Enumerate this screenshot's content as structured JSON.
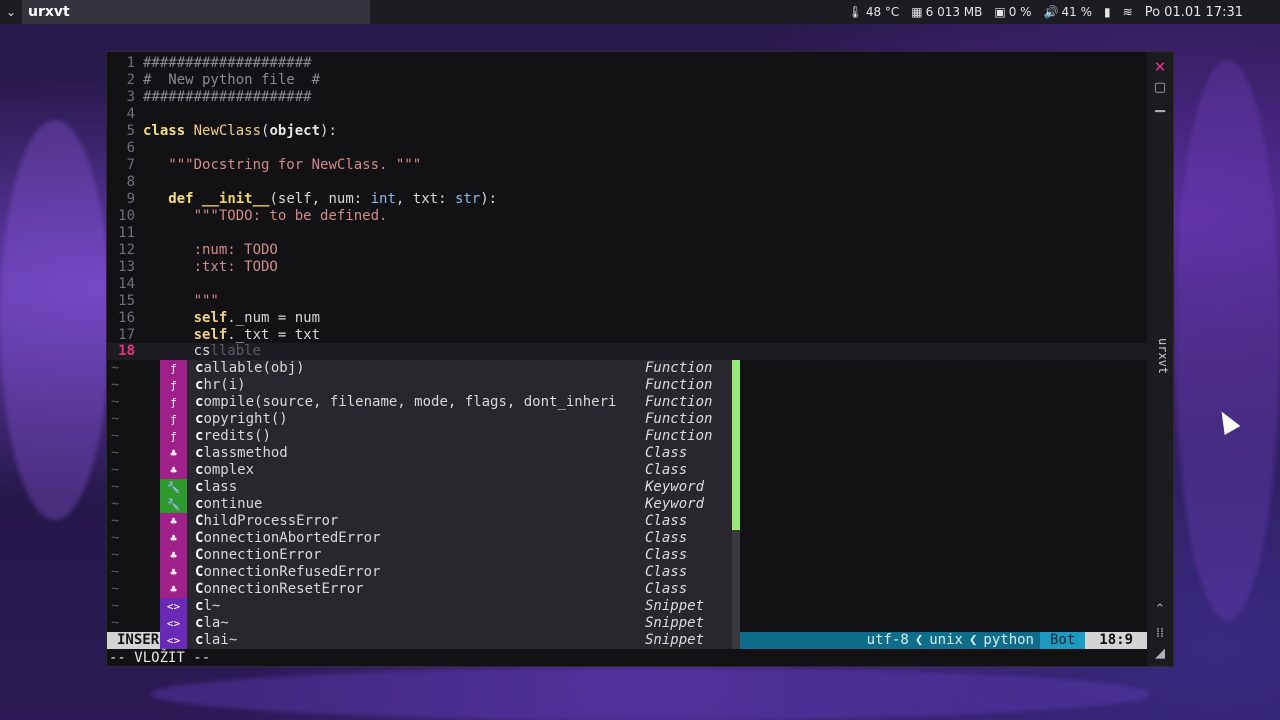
{
  "topbar": {
    "app_title": "urxvt",
    "temp": "48 °C",
    "memory": "6 013 MB",
    "cpu": "0 %",
    "volume": "41 %",
    "clock": "Po 01.01 17:31"
  },
  "window": {
    "wm_label": "urxvt"
  },
  "editor": {
    "lines": [
      {
        "n": "1",
        "t": "####################"
      },
      {
        "n": "2",
        "t": "#  New python file  #"
      },
      {
        "n": "3",
        "t": "####################"
      },
      {
        "n": "4",
        "t": ""
      },
      {
        "n": "5",
        "kw": "class",
        "cls": "NewClass",
        "bi": "object"
      },
      {
        "n": "6",
        "t": ""
      },
      {
        "n": "7",
        "str": "\"\"\"Docstring for NewClass. \"\"\""
      },
      {
        "n": "8",
        "t": ""
      },
      {
        "n": "9",
        "kw": "def",
        "fn": "__init__",
        "params_a": "(self, num: ",
        "ty1": "int",
        "params_b": ", txt: ",
        "ty2": "str",
        "params_c": "):"
      },
      {
        "n": "10",
        "str": "\"\"\"TODO: to be defined."
      },
      {
        "n": "11",
        "t": ""
      },
      {
        "n": "12",
        "str": ":num: TODO"
      },
      {
        "n": "13",
        "str": ":txt: TODO"
      },
      {
        "n": "14",
        "t": ""
      },
      {
        "n": "15",
        "str": "\"\"\""
      },
      {
        "n": "16",
        "self": "self",
        "rest": "._num = num"
      },
      {
        "n": "17",
        "self": "self",
        "rest": "._txt = txt"
      },
      {
        "n": "18",
        "typed": "cs",
        "ghost": "llable"
      }
    ],
    "tilde": "~"
  },
  "completion": {
    "items": [
      {
        "icon": "function-icon",
        "glyph": "ƒ",
        "color": "#a0208a",
        "first": "c",
        "rest": "allable(obj)",
        "kind": "Function"
      },
      {
        "icon": "function-icon",
        "glyph": "ƒ",
        "color": "#a0208a",
        "first": "c",
        "rest": "hr(i)",
        "kind": "Function"
      },
      {
        "icon": "function-icon",
        "glyph": "ƒ",
        "color": "#a0208a",
        "first": "c",
        "rest": "ompile(source, filename, mode, flags, dont_inheri",
        "kind": "Function"
      },
      {
        "icon": "function-icon",
        "glyph": "ƒ",
        "color": "#a0208a",
        "first": "c",
        "rest": "opyright()",
        "kind": "Function"
      },
      {
        "icon": "function-icon",
        "glyph": "ƒ",
        "color": "#a0208a",
        "first": "c",
        "rest": "redits()",
        "kind": "Function"
      },
      {
        "icon": "class-icon",
        "glyph": "♣",
        "color": "#a0208a",
        "first": "c",
        "rest": "lassmethod",
        "kind": "Class"
      },
      {
        "icon": "class-icon",
        "glyph": "♣",
        "color": "#a0208a",
        "first": "c",
        "rest": "omplex",
        "kind": "Class"
      },
      {
        "icon": "keyword-icon",
        "glyph": "🔧",
        "color": "#2e9a2e",
        "first": "c",
        "rest": "lass",
        "kind": "Keyword"
      },
      {
        "icon": "keyword-icon",
        "glyph": "🔧",
        "color": "#2e9a2e",
        "first": "c",
        "rest": "ontinue",
        "kind": "Keyword"
      },
      {
        "icon": "class-icon",
        "glyph": "♣",
        "color": "#a0208a",
        "first": "C",
        "rest": "hildProcessError",
        "kind": "Class"
      },
      {
        "icon": "class-icon",
        "glyph": "♣",
        "color": "#a0208a",
        "first": "C",
        "rest": "onnectionAbortedError",
        "kind": "Class"
      },
      {
        "icon": "class-icon",
        "glyph": "♣",
        "color": "#a0208a",
        "first": "C",
        "rest": "onnectionError",
        "kind": "Class"
      },
      {
        "icon": "class-icon",
        "glyph": "♣",
        "color": "#a0208a",
        "first": "C",
        "rest": "onnectionRefusedError",
        "kind": "Class"
      },
      {
        "icon": "class-icon",
        "glyph": "♣",
        "color": "#a0208a",
        "first": "C",
        "rest": "onnectionResetError",
        "kind": "Class"
      },
      {
        "icon": "snippet-icon",
        "glyph": "<>",
        "color": "#6a2ab8",
        "first": "c",
        "rest": "l~",
        "kind": "Snippet"
      },
      {
        "icon": "snippet-icon",
        "glyph": "<>",
        "color": "#6a2ab8",
        "first": "c",
        "rest": "la~",
        "kind": "Snippet"
      },
      {
        "icon": "snippet-icon",
        "glyph": "<>",
        "color": "#6a2ab8",
        "first": "c",
        "rest": "lai~",
        "kind": "Snippet"
      }
    ]
  },
  "statusline": {
    "mode": "INSER",
    "encoding": "utf-8",
    "format": "unix",
    "filetype": "python",
    "scroll": "Bot",
    "position": "18:9"
  },
  "cmdline": "-- VLOŽIT --"
}
